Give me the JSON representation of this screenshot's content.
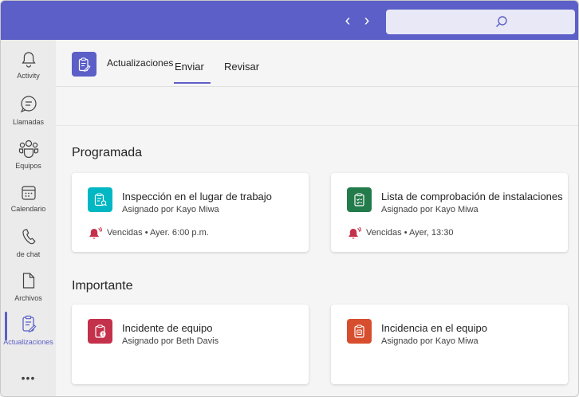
{
  "topbar": {
    "back_icon": "chevron-left-icon",
    "forward_icon": "chevron-right-icon",
    "search_icon": "search-icon",
    "color": "#5b5fc7"
  },
  "rail": {
    "items": [
      {
        "label": "Activity",
        "icon": "bell-icon"
      },
      {
        "label": "Llamadas",
        "icon": "chat-bubble-icon"
      },
      {
        "label": "Equipos",
        "icon": "teams-people-icon"
      },
      {
        "label": "Calendario",
        "icon": "calendar-icon"
      },
      {
        "label": "de chat",
        "icon": "phone-icon"
      },
      {
        "label": "Archivos",
        "icon": "file-icon"
      },
      {
        "label": "Actualizaciones",
        "icon": "updates-clipboard-icon",
        "active": true
      }
    ],
    "more": "•••"
  },
  "app": {
    "title": "Actualizaciones",
    "tabs": [
      "Enviar",
      "Revisar"
    ],
    "active_tab": "Enviar"
  },
  "sections": [
    {
      "title": "Programada",
      "cards": [
        {
          "title": "Inspección en el lugar de trabajo",
          "subtitle": "Asignado por Kayo Miwa",
          "due": "Vencidas • Ayer. 6:00 p.m.",
          "icon_color": "#00b7c3",
          "icon": "inspection-icon"
        },
        {
          "title": "Lista de comprobación de instalaciones",
          "subtitle": "Asignado por Kayo Miwa",
          "due": "Vencidas • Ayer, 13:30",
          "icon_color": "#237b4b",
          "icon": "checklist-icon"
        }
      ]
    },
    {
      "title": "Importante",
      "cards": [
        {
          "title": "Incidente de equipo",
          "subtitle": "Asignado por Beth Davis",
          "icon_color": "#c4314b",
          "icon": "incident-icon"
        },
        {
          "title": "Incidencia en el equipo",
          "subtitle": "Asignado por Kayo Miwa",
          "icon_color": "#d74e2f",
          "icon": "equipment-issue-icon"
        }
      ]
    }
  ],
  "colors": {
    "accent": "#5b5fc7",
    "overdue": "#c4314b"
  }
}
